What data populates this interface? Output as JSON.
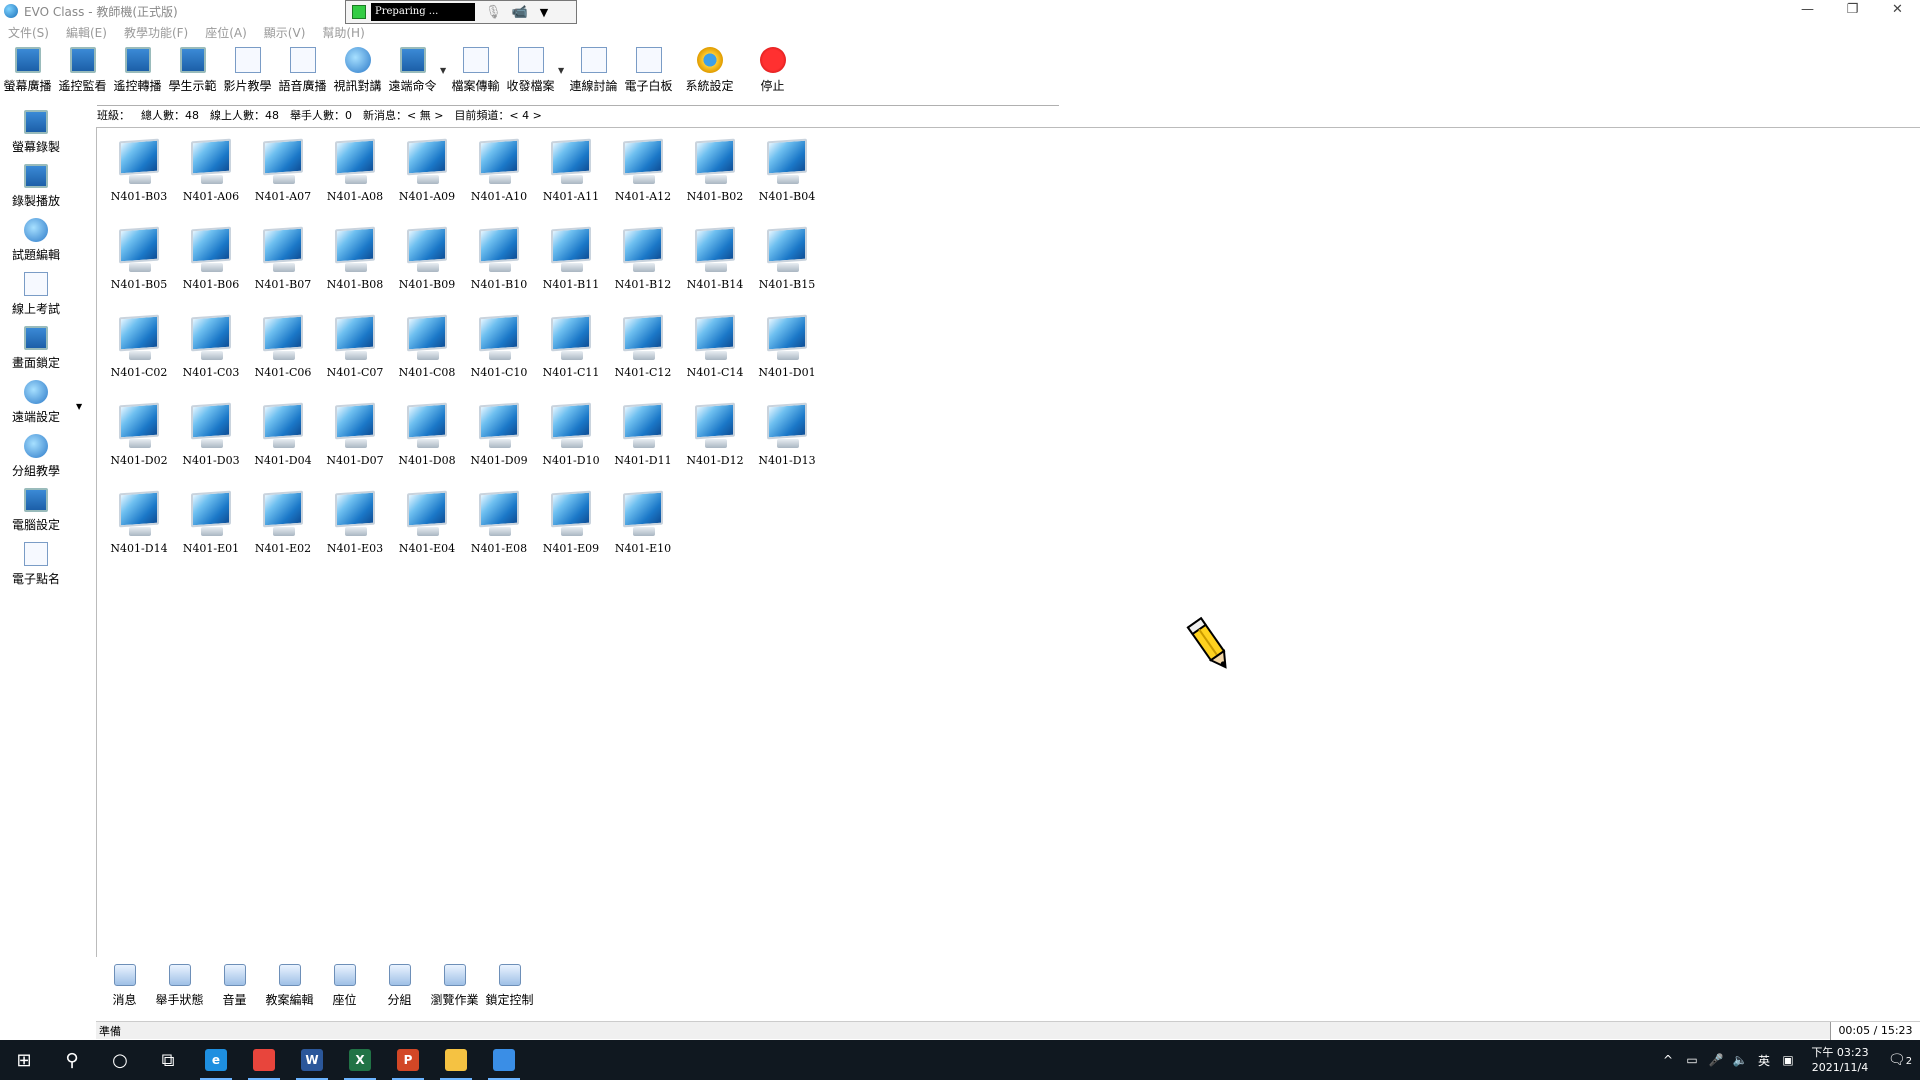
{
  "window": {
    "title": "EVO Class - 教師機(正式版)",
    "preparing_label": "Preparing ...",
    "controls": [
      "—",
      "❐",
      "✕"
    ]
  },
  "menu": [
    "文件(S)",
    "編輯(E)",
    "教學功能(F)",
    "座位(A)",
    "顯示(V)",
    "幫助(H)"
  ],
  "toolbar": [
    {
      "label": "螢幕廣播",
      "icon": "screen-broadcast-icon"
    },
    {
      "label": "遙控監看",
      "icon": "remote-monitor-icon"
    },
    {
      "label": "遙控轉播",
      "icon": "remote-relay-icon"
    },
    {
      "label": "學生示範",
      "icon": "student-demo-icon"
    },
    {
      "label": "影片教學",
      "icon": "video-teaching-icon"
    },
    {
      "label": "語音廣播",
      "icon": "voice-broadcast-icon"
    },
    {
      "label": "視訊對講",
      "icon": "video-intercom-icon"
    },
    {
      "label": "遠端命令",
      "icon": "remote-command-icon"
    },
    {
      "label": "檔案傳輸",
      "icon": "file-transfer-icon"
    },
    {
      "label": "收發檔案",
      "icon": "send-receive-files-icon"
    },
    {
      "label": "連線討論",
      "icon": "online-discussion-icon"
    },
    {
      "label": "電子白板",
      "icon": "whiteboard-icon"
    },
    {
      "label": "系統設定",
      "icon": "system-settings-icon"
    },
    {
      "label": "停止",
      "icon": "stop-icon"
    }
  ],
  "info": {
    "class_label": "班級：",
    "total": "總人數：48",
    "online": "線上人數：48",
    "raised": "舉手人數：0",
    "news": "新消息：< 無 >",
    "channel": "目前頻道：< 4 >"
  },
  "sidebar": [
    {
      "label": "螢幕錄製",
      "icon": "screen-record-icon"
    },
    {
      "label": "錄製播放",
      "icon": "record-playback-icon"
    },
    {
      "label": "試題編輯",
      "icon": "quiz-edit-icon"
    },
    {
      "label": "線上考試",
      "icon": "online-exam-icon"
    },
    {
      "label": "畫面鎖定",
      "icon": "screen-lock-icon"
    },
    {
      "label": "遠端設定",
      "icon": "remote-settings-icon"
    },
    {
      "label": "分組教學",
      "icon": "group-teaching-icon"
    },
    {
      "label": "電腦設定",
      "icon": "computer-settings-icon"
    },
    {
      "label": "電子點名",
      "icon": "roll-call-icon"
    }
  ],
  "computers": [
    "N401-B03",
    "N401-A06",
    "N401-A07",
    "N401-A08",
    "N401-A09",
    "N401-A10",
    "N401-A11",
    "N401-A12",
    "N401-B02",
    "N401-B04",
    "N401-B05",
    "N401-B06",
    "N401-B07",
    "N401-B08",
    "N401-B09",
    "N401-B10",
    "N401-B11",
    "N401-B12",
    "N401-B14",
    "N401-B15",
    "N401-C02",
    "N401-C03",
    "N401-C06",
    "N401-C07",
    "N401-C08",
    "N401-C10",
    "N401-C11",
    "N401-C12",
    "N401-C14",
    "N401-D01",
    "N401-D02",
    "N401-D03",
    "N401-D04",
    "N401-D07",
    "N401-D08",
    "N401-D09",
    "N401-D10",
    "N401-D11",
    "N401-D12",
    "N401-D13",
    "N401-D14",
    "N401-E01",
    "N401-E02",
    "N401-E03",
    "N401-E04",
    "N401-E08",
    "N401-E09",
    "N401-E10"
  ],
  "bottom_toolbar": [
    {
      "label": "消息",
      "icon": "message-icon"
    },
    {
      "label": "舉手狀態",
      "icon": "hand-raise-icon"
    },
    {
      "label": "音量",
      "icon": "volume-icon"
    },
    {
      "label": "教案編輯",
      "icon": "lesson-edit-icon"
    },
    {
      "label": "座位",
      "icon": "seat-icon"
    },
    {
      "label": "分組",
      "icon": "group-icon"
    },
    {
      "label": "瀏覽作業",
      "icon": "browse-homework-icon"
    },
    {
      "label": "鎖定控制",
      "icon": "lock-control-icon"
    }
  ],
  "status": {
    "text": "準備",
    "time": "00:05 / 15:23"
  },
  "taskbar": {
    "apps": [
      {
        "name": "edge",
        "label": "e",
        "color": "#1e8fe0"
      },
      {
        "name": "chrome",
        "label": "",
        "color": "#e8453c"
      },
      {
        "name": "word",
        "label": "W",
        "color": "#2b579a"
      },
      {
        "name": "excel",
        "label": "X",
        "color": "#217346"
      },
      {
        "name": "powerpoint",
        "label": "P",
        "color": "#d24726"
      },
      {
        "name": "file-explorer",
        "label": "",
        "color": "#f5c242"
      },
      {
        "name": "evo-class",
        "label": "",
        "color": "#3a8ee6"
      }
    ],
    "ime": "英",
    "clock_time": "下午 03:23",
    "clock_date": "2021/11/4",
    "notifications": "2"
  },
  "colors": {
    "accent": "#1c5fa8",
    "taskbar_bg": "#101820",
    "preparing_indicator": "#33cc44"
  }
}
